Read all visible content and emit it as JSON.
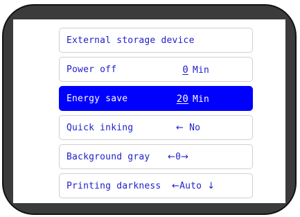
{
  "menu": {
    "items": [
      {
        "label": "External storage device"
      },
      {
        "label": "Power off",
        "value": "0",
        "unit": "Min"
      },
      {
        "label": "Energy save",
        "value": "20",
        "unit": "Min",
        "selected": true
      },
      {
        "label": "Quick inking",
        "arrow_left": "←",
        "value": "No"
      },
      {
        "label": "Background gray",
        "arrow_left": "←",
        "value": "0",
        "arrow_right": "→"
      },
      {
        "label": "Printing darkness",
        "arrow_left": "←",
        "value": "Auto",
        "arrow_down": "↓"
      }
    ]
  },
  "colors": {
    "bezel": "#3b3b3b",
    "selected_bg": "#0000ff",
    "text": "#2020cc",
    "selected_text": "#ffffff"
  }
}
